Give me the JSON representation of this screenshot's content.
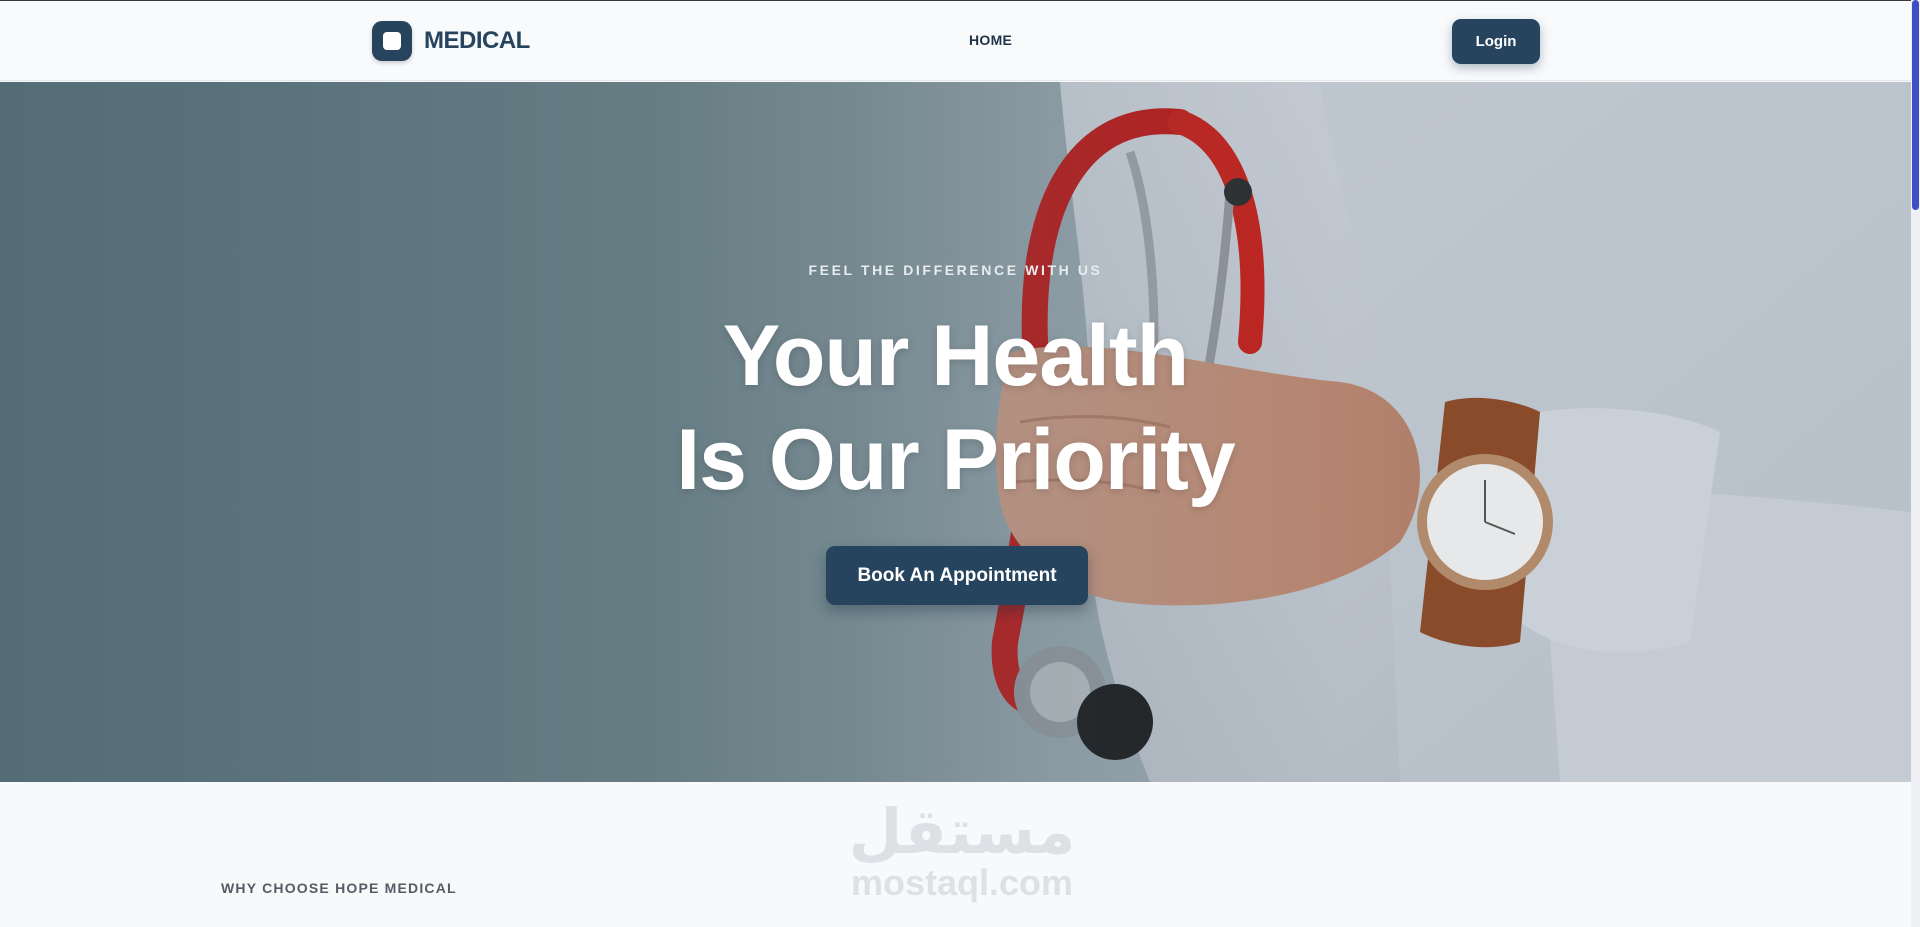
{
  "header": {
    "logo_text": "MEDICAL",
    "nav": [
      {
        "label": "HOME"
      }
    ],
    "login_label": "Login"
  },
  "hero": {
    "eyebrow": "FEEL THE DIFFERENCE WITH US",
    "title_line1": "Your Health",
    "title_line2": "Is Our Priority",
    "cta_label": "Book An Appointment"
  },
  "section": {
    "label": "WHY CHOOSE HOPE MEDICAL"
  },
  "watermark": {
    "arabic": "مستقل",
    "latin": "mostaql.com"
  },
  "colors": {
    "brand": "#27445f",
    "scroll_thumb": "#3e4fc6"
  }
}
